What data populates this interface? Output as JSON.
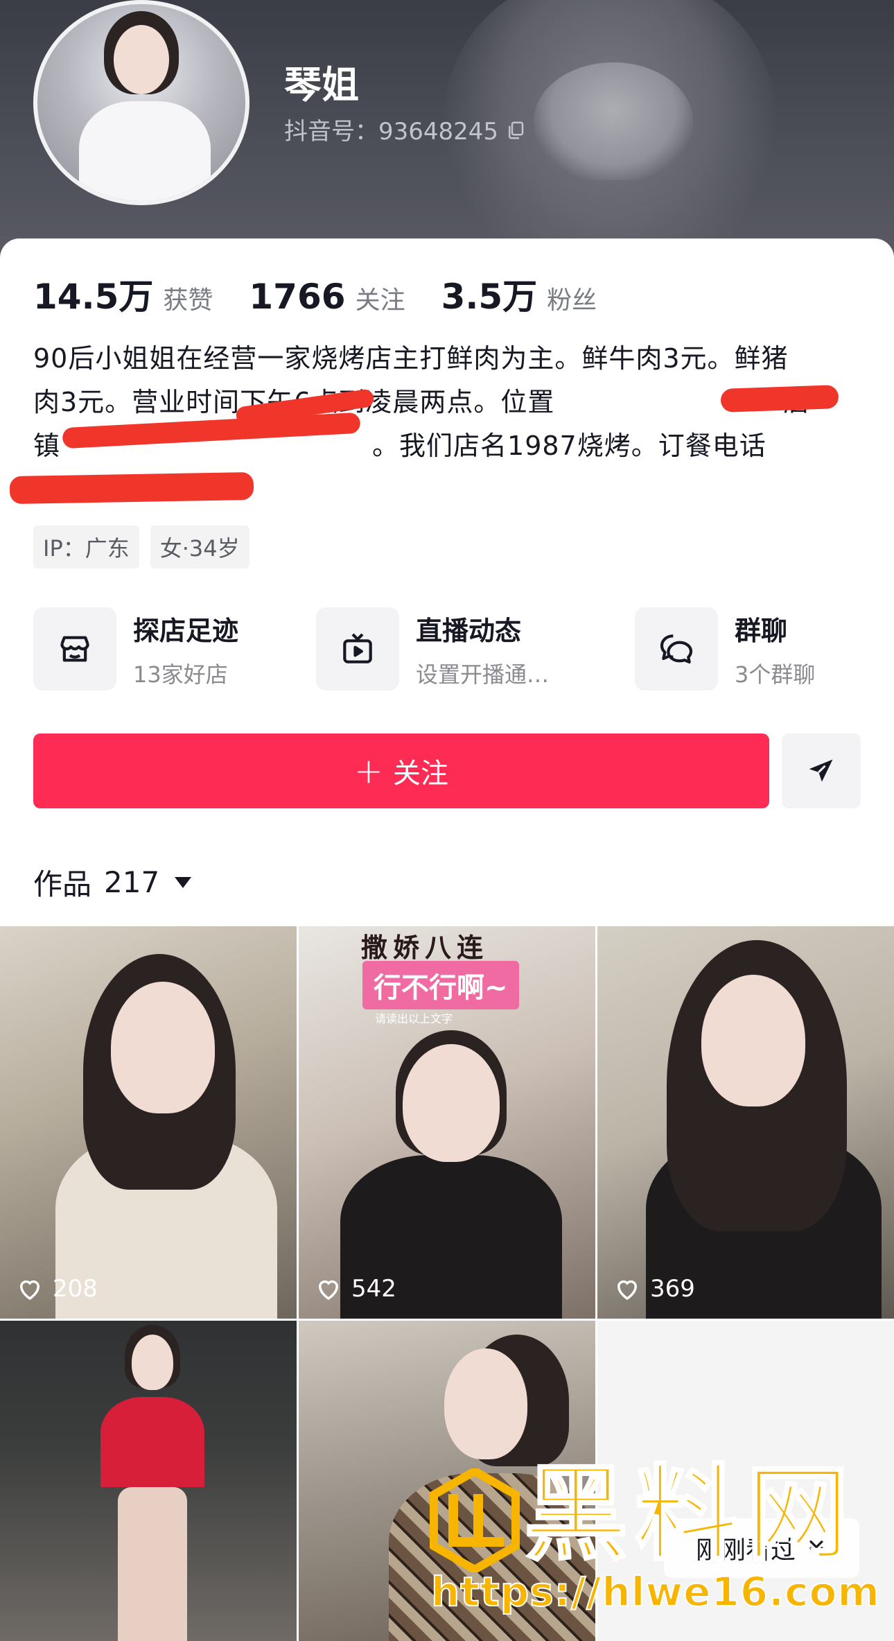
{
  "profile": {
    "name": "琴姐",
    "douyin_id": "抖音号：93648245"
  },
  "stats": [
    {
      "value": "14.5万",
      "label": "获赞"
    },
    {
      "value": "1766",
      "label": "关注"
    },
    {
      "value": "3.5万",
      "label": "粉丝"
    }
  ],
  "bio": {
    "line1": "90后小姐姐在经营一家烧烤店主打鲜肉为主。鲜牛肉3元。鲜猪",
    "line2": "肉3元。营业时间下午6点到凌晨两点。位置",
    "line2_tail": "店",
    "line3": "镇",
    "line3_tail": "。我们店名1987烧烤。订餐电话"
  },
  "tags": [
    "IP：广东",
    "女·34岁"
  ],
  "shortcuts": [
    {
      "title": "探店足迹",
      "subtitle": "13家好店",
      "icon": "store-icon"
    },
    {
      "title": "直播动态",
      "subtitle": "设置开播通…",
      "icon": "tv-icon"
    },
    {
      "title": "群聊",
      "subtitle": "3个群聊",
      "icon": "chat-bubbles-icon"
    }
  ],
  "actions": {
    "follow_plus": "+",
    "follow_label": "关注",
    "share_icon": "send-icon"
  },
  "works": {
    "label": "作品",
    "count": "217"
  },
  "videos": [
    {
      "likes": "208"
    },
    {
      "likes": "542",
      "overlay_title": "撒娇八连",
      "overlay_pink": "行不行啊~",
      "overlay_small": "请读出以上文字"
    },
    {
      "likes": "369"
    },
    {},
    {},
    {}
  ],
  "recently_viewed": "刚刚看过",
  "watermark": {
    "title": "黑料网",
    "url": "https://hlwe16.com"
  },
  "colors": {
    "follow_button": "#fe2c55",
    "redaction": "#f0352b",
    "watermark": "#f7b500"
  }
}
